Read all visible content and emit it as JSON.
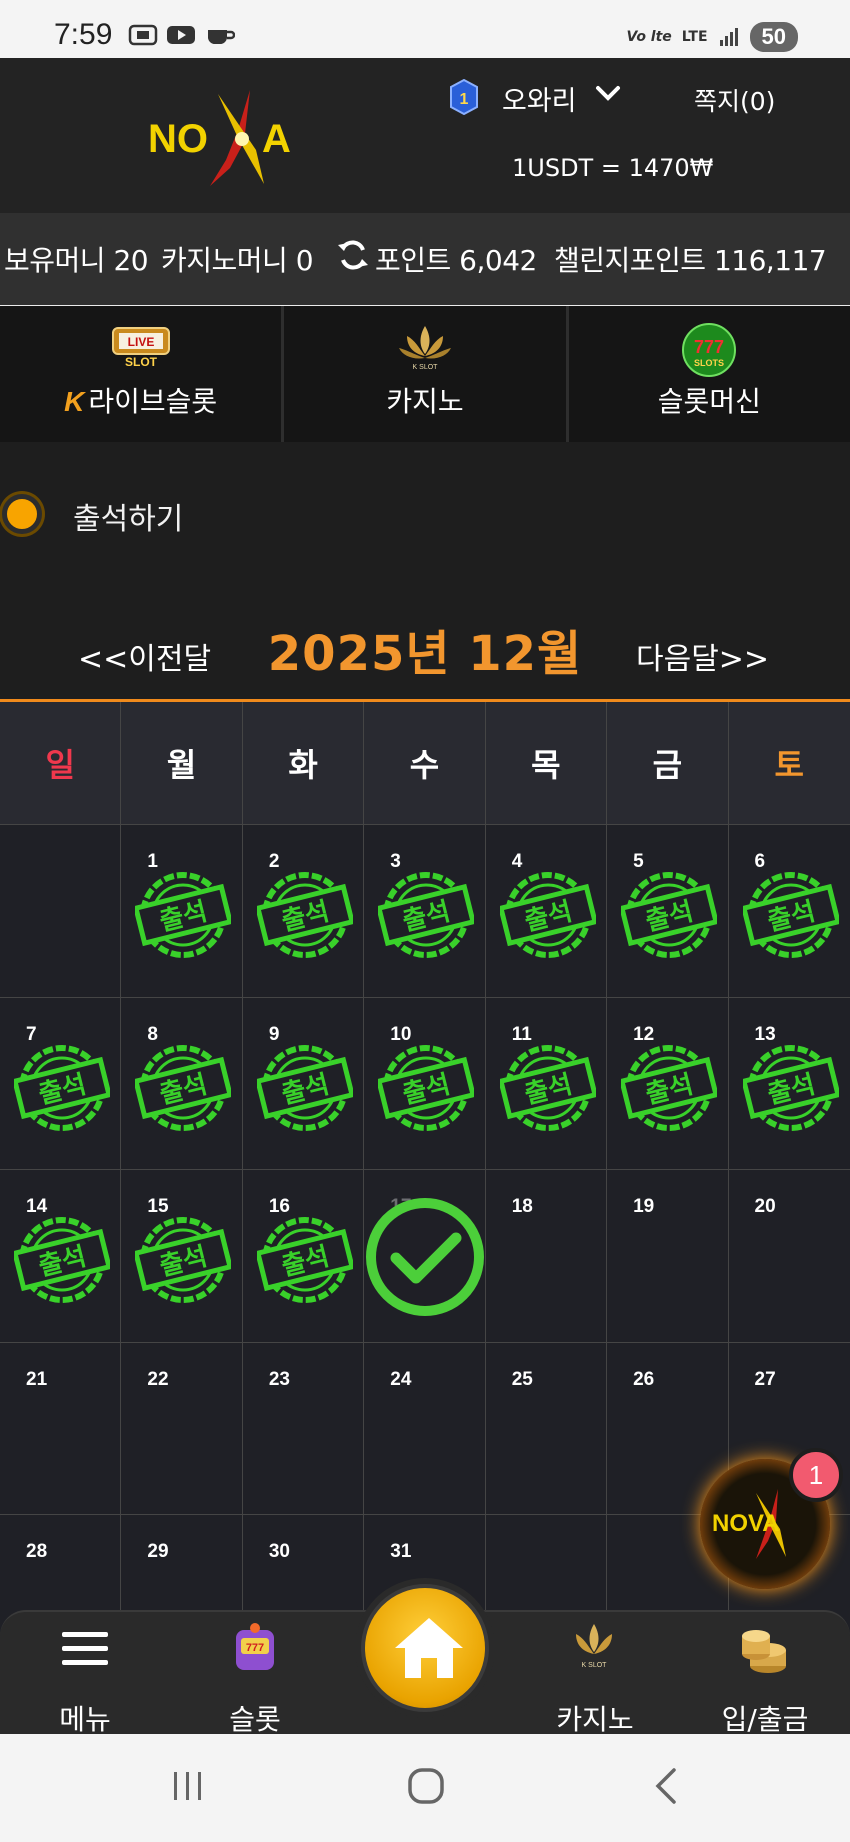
{
  "status_bar": {
    "time": "7:59",
    "network": "LTE",
    "battery": "50",
    "icons": [
      "screenshot-icon",
      "youtube-icon",
      "cup-icon",
      "volte-icon",
      "lte-icon",
      "signal-icon",
      "battery-icon"
    ]
  },
  "header": {
    "logo_text": "NOVA",
    "rank_level": "1",
    "username": "오와리",
    "memo": "쪽지(0)",
    "rate": "1USDT = 1470₩"
  },
  "money_bar": {
    "holding": "보유머니 20",
    "casino_money": "카지노머니 0",
    "points": "포인트 6,042",
    "challenge_points": "챌린지포인트 116,117"
  },
  "game_tabs": [
    {
      "label": "라이브슬롯",
      "icon": "live-slot-icon",
      "prefix": "K"
    },
    {
      "label": "카지노",
      "icon": "k-slot-casino-icon"
    },
    {
      "label": "슬롯머신",
      "icon": "777-slots-icon"
    }
  ],
  "attendance": {
    "title": "출석하기",
    "prev": "<<이전달",
    "next": "다음달>>",
    "month": "2025년 12월",
    "weekdays": [
      "일",
      "월",
      "화",
      "수",
      "목",
      "금",
      "토"
    ],
    "stamp_text": "출석",
    "checked_days": [
      1,
      2,
      3,
      4,
      5,
      6,
      7,
      8,
      9,
      10,
      11,
      12,
      13,
      14,
      15,
      16
    ],
    "today": 17,
    "weeks": [
      [
        "",
        "1",
        "2",
        "3",
        "4",
        "5",
        "6"
      ],
      [
        "7",
        "8",
        "9",
        "10",
        "11",
        "12",
        "13"
      ],
      [
        "14",
        "15",
        "16",
        "17",
        "18",
        "19",
        "20"
      ],
      [
        "21",
        "22",
        "23",
        "24",
        "25",
        "26",
        "27"
      ],
      [
        "28",
        "29",
        "30",
        "31",
        "",
        "",
        ""
      ]
    ]
  },
  "floating_badge": {
    "count": "1",
    "logo_text": "NOVA"
  },
  "bottom_nav": {
    "menu": "메뉴",
    "slot": "슬롯",
    "casino": "카지노",
    "deposit": "입/출금"
  },
  "colors": {
    "accent_orange": "#f2962e",
    "sunday_red": "#f0384d",
    "stamp_green": "#39d12a",
    "badge_pink": "#f25a6f"
  }
}
